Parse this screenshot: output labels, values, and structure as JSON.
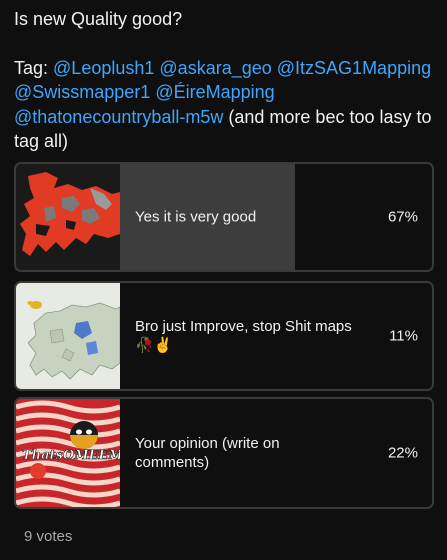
{
  "post": {
    "question": "Is new Quality good?",
    "tag_prefix": "Tag: ",
    "mentions": [
      "@Leoplush1",
      "@askara_geo",
      "@ItzSAG1Mapping",
      "@Swissmapper1",
      "@ÉireMapping",
      "@thatonecountryball-m5w"
    ],
    "tag_suffix": "(and more bec too lasy to tag all)"
  },
  "poll": {
    "options": [
      {
        "label": "Yes it is very good",
        "percent_text": "67%",
        "percent": 67,
        "thumbnail": "europe-map-red-thumbnail"
      },
      {
        "label": "Bro just Improve, stop Shit maps🥀✌️",
        "percent_text": "11%",
        "percent": 11,
        "thumbnail": "europe-map-light-thumbnail"
      },
      {
        "label": "Your opinion (write on comments)",
        "percent_text": "22%",
        "percent": 22,
        "thumbnail": "thatomeem-logo-thumbnail",
        "thumbnail_text": "ThatsOMEEM"
      }
    ],
    "votes_text": "9 votes"
  },
  "colors": {
    "background": "#0f0f0f",
    "mention": "#3ea6ff",
    "bar_fill": "#3d3d3d",
    "border": "#3a3a3a"
  }
}
